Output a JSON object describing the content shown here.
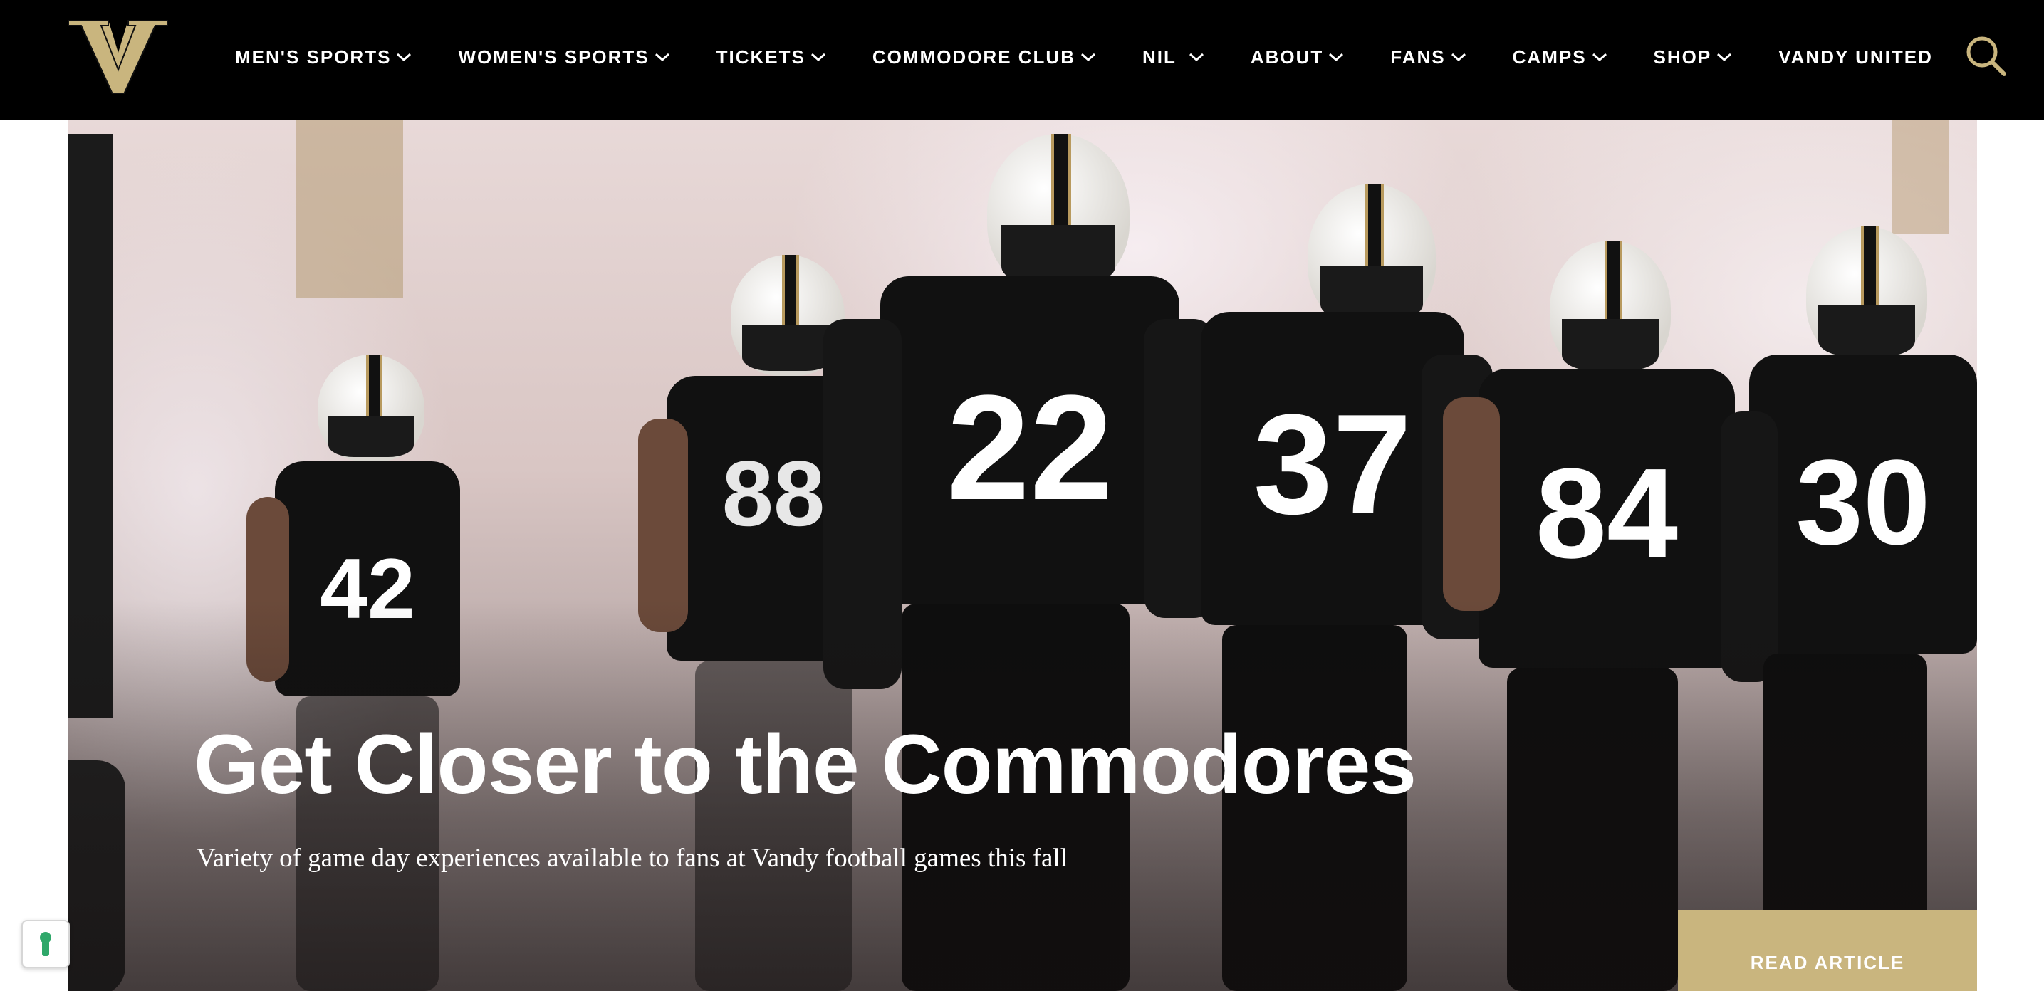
{
  "header": {
    "logo_icon": "vanderbilt-v-logo",
    "nav": [
      {
        "label": "MEN'S SPORTS",
        "has_dropdown": true
      },
      {
        "label": "WOMEN'S SPORTS",
        "has_dropdown": true
      },
      {
        "label": "TICKETS",
        "has_dropdown": true
      },
      {
        "label": "COMMODORE CLUB",
        "has_dropdown": true
      },
      {
        "label": "NIL",
        "has_dropdown": true
      },
      {
        "label": "ABOUT",
        "has_dropdown": true
      },
      {
        "label": "FANS",
        "has_dropdown": true
      },
      {
        "label": "CAMPS",
        "has_dropdown": true
      },
      {
        "label": "SHOP",
        "has_dropdown": true
      },
      {
        "label": "VANDY UNITED",
        "has_dropdown": false
      }
    ],
    "search_icon": "search-icon"
  },
  "hero": {
    "title": "Get Closer to the Commodores",
    "subtitle": "Variety of game day experiences available to fans at Vandy football games this fall",
    "cta_label": "READ ARTICLE",
    "jersey_numbers": [
      "42",
      "88",
      "22",
      "37",
      "84",
      "30"
    ]
  },
  "colors": {
    "nav_background": "#000000",
    "brand_gold": "#c9b57e",
    "text_white": "#ffffff"
  },
  "floating": {
    "privacy_icon": "privacy-settings-icon"
  }
}
